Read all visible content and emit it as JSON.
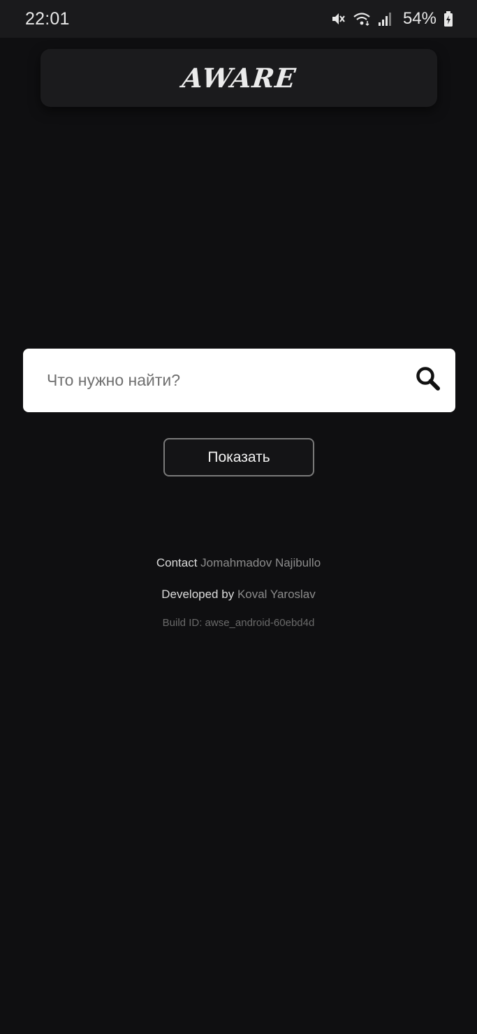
{
  "status_bar": {
    "time": "22:01",
    "battery_percent": "54%",
    "icons": [
      "mute-icon",
      "wifi-icon",
      "signal-icon",
      "battery-icon"
    ]
  },
  "header": {
    "logo_text": "AWARE"
  },
  "search": {
    "placeholder": "Что нужно найти?",
    "value": "",
    "icon": "search-icon"
  },
  "actions": {
    "show_label": "Показать"
  },
  "footer": {
    "contact_label": "Contact",
    "contact_name": "Jomahmadov Najibullo",
    "developed_label": "Developed by",
    "developer_name": "Koval Yaroslav",
    "build_id": "Build ID: awse_android-60ebd4d"
  },
  "colors": {
    "background": "#0f0f11",
    "card": "#1b1b1d",
    "search_bg": "#ffffff",
    "button_border": "#7a7a7a"
  }
}
